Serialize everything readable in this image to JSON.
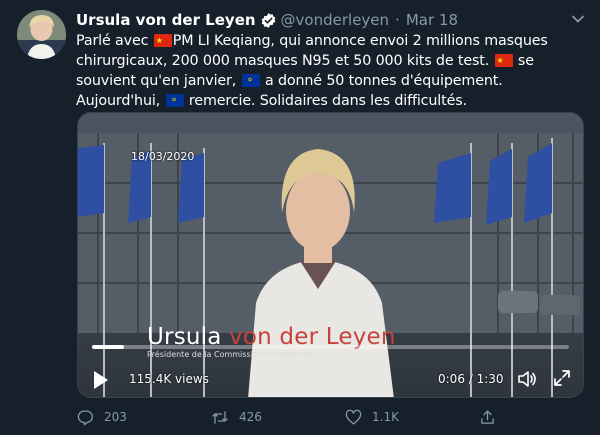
{
  "author": {
    "name": "Ursula von der Leyen",
    "handle": "@vonderleyen",
    "separator": "·",
    "date": "Mar 18",
    "verified_icon": "verified-badge-icon"
  },
  "tweet": {
    "parts": [
      "Parlé avec ",
      "PM LI Keqiang, qui annonce envoi 2 millions masques chirurgicaux, 200 000 masques N95 et 50 000 kits de test. ",
      " se souvient qu'en janvier, ",
      " a donné 50 tonnes d'équipement. Aujourd'hui, ",
      " remercie. Solidaires dans les difficultés."
    ],
    "flags": [
      "flag-china-icon",
      "flag-china-icon",
      "flag-eu-icon",
      "flag-eu-icon"
    ]
  },
  "video": {
    "date_overlay": "18/03/2020",
    "lower_third_first": "Ursula ",
    "lower_third_last": "von der Leyen",
    "lower_third_subtitle": "Présidente de la Commission européenne",
    "views": "115.4K views",
    "timecode": "0:06 / 1:30",
    "progress_fraction": 0.067
  },
  "actions": {
    "replies": "203",
    "retweets": "426",
    "likes": "1.1K"
  },
  "colors": {
    "background": "#15202b",
    "muted": "#8899a6",
    "verified": "#1da1f2",
    "name_highlight": "#c6423b"
  }
}
